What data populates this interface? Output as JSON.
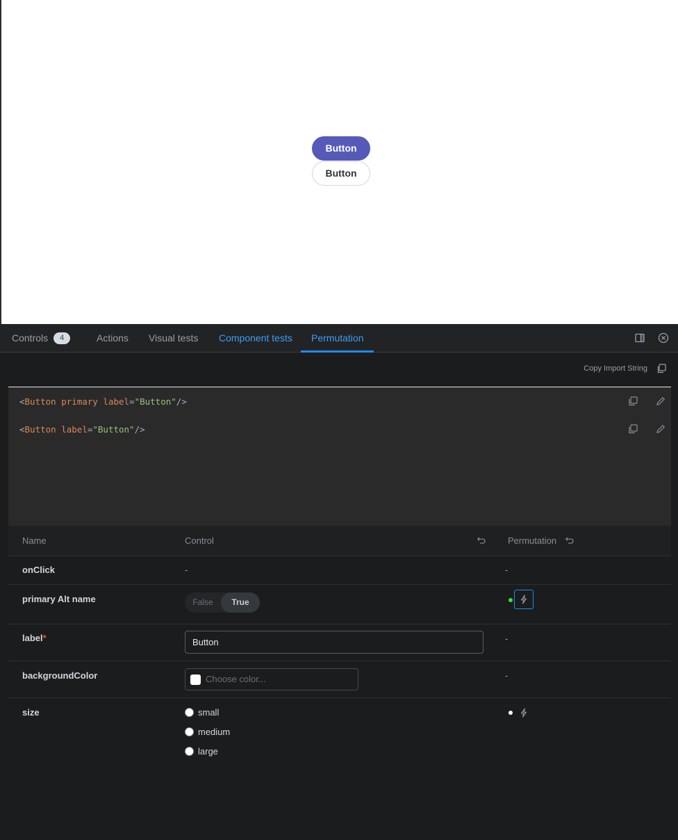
{
  "preview": {
    "primary_button_label": "Button",
    "secondary_button_label": "Button"
  },
  "tabs": {
    "controls": "Controls",
    "controls_count": "4",
    "actions": "Actions",
    "visual_tests": "Visual tests",
    "component_tests": "Component tests",
    "permutation": "Permutation"
  },
  "icons": {
    "panel_toggle": "panel-layout-icon",
    "close": "close-circle-icon",
    "copy": "copy-icon",
    "edit": "pencil-icon",
    "reset": "undo-icon",
    "bolt": "lightning-icon"
  },
  "permutation": {
    "copy_import_label": "Copy Import String",
    "code_lines": [
      {
        "open": "<",
        "tag": "Button",
        "attrs": " primary label",
        "eq": "=",
        "value": "\"Button\"",
        "close": "/>"
      },
      {
        "open": "<",
        "tag": "Button",
        "attrs": " label",
        "eq": "=",
        "value": "\"Button\"",
        "close": "/>"
      }
    ]
  },
  "table": {
    "headers": {
      "name": "Name",
      "control": "Control",
      "permutation": "Permutation"
    },
    "rows": {
      "onclick": {
        "name": "onClick",
        "control": "-",
        "permutation": "-"
      },
      "primary": {
        "name": "primary Alt name",
        "false_label": "False",
        "true_label": "True",
        "selected": "True"
      },
      "label": {
        "name": "label",
        "required_mark": "*",
        "value": "Button",
        "permutation": "-"
      },
      "background": {
        "name": "backgroundColor",
        "placeholder": "Choose color...",
        "permutation": "-"
      },
      "size": {
        "name": "size",
        "options": [
          "small",
          "medium",
          "large"
        ]
      }
    }
  },
  "colors": {
    "primary_button": "#555ab9",
    "accent_blue": "#1e8bf0",
    "panel_bg": "#1b1c1d",
    "active_dot": "#3ddc3d",
    "required": "#e4572e"
  }
}
